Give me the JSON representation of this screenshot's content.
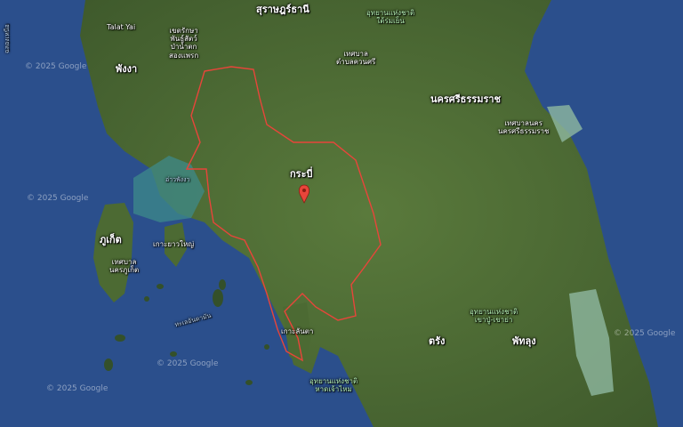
{
  "map": {
    "labels": {
      "surat_thani": "สุราษฎร์ธานี",
      "park_tai_rom_yen": "อุทยานแห่งชาติ\nใต้ร่มเย็น",
      "talat_yai": "Talat Yai",
      "khet_rakhsa": "เขตรักษา\nพันธุ์สัตว์\nป่าน้ำตก\nสองแพรก",
      "phang_nga": "พังงา",
      "thetsaban_tambon": "เทศบาล\nตำบลควนศรี",
      "nakhon_si_thammarat": "นครศรีธรรมราช",
      "thetsaban_nakhon": "เทศบาลนคร\nนครศรีธรรมราช",
      "ao_phang_nga": "อ่าวพังงา",
      "krabi": "กระบี่",
      "phuket": "ภูเก็ต",
      "ko_yao_yai": "เกาะยาวใหญ่",
      "thetsaban_phuket": "เทศบาล\nนครภูเก็ต",
      "sea_andaman": "ทะเลอันดามัน",
      "park_khao_pu": "อุทยานแห่งชาติ\nเขาปู่-เขาย่า",
      "ko_lanta": "เกาะลันตา",
      "trang": "ตรัง",
      "phatthalung": "พัทลุง",
      "park_hat_chao_mai": "อุทยานแห่งชาติ\nหาดเจ้าไหม",
      "left_vertical": "ฉลองเหนือ"
    },
    "watermarks": [
      "© 2025 Google",
      "© 2025 Google",
      "© 2025 Google",
      "© 2025 Google",
      "© 2025 Google"
    ],
    "colors": {
      "water": "#2b4f8c",
      "land": "#4d6b34",
      "boundary": "#e8453a",
      "pin": "#e8453a"
    }
  }
}
